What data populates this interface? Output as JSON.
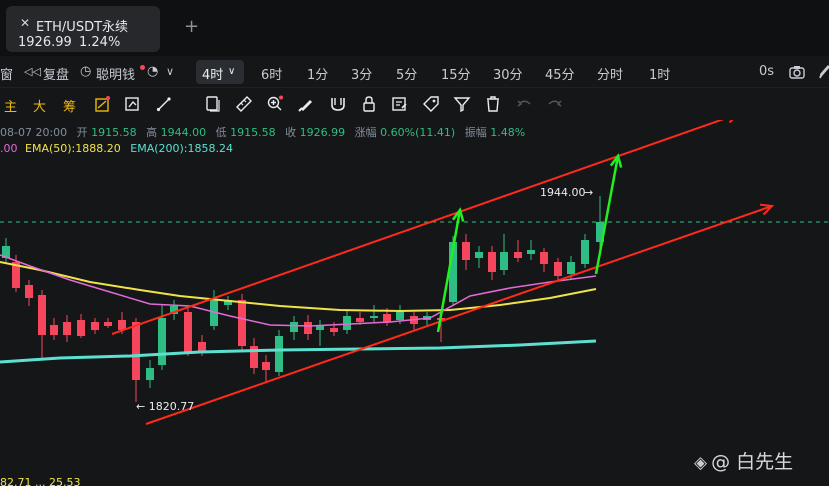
{
  "tab": {
    "close": "✕",
    "title": "ETH/USDT永续",
    "price": "1926.99",
    "change": "1.24%",
    "add": "+"
  },
  "toolbar1": {
    "window_label": "窗",
    "replay_label": "复盘",
    "smart_label": "聪明钱",
    "interval_active": "4时",
    "intervals": [
      "6时",
      "1分",
      "3分",
      "5分",
      "15分",
      "30分",
      "45分",
      "分时",
      "1时"
    ],
    "right_label": "0s"
  },
  "toolbar2": {
    "main_label": "主",
    "big_label": "大",
    "chip_label": "筹"
  },
  "info": {
    "date": "08-07 20:00",
    "open_label": "开",
    "open": "1915.58",
    "high_label": "高",
    "high": "1944.00",
    "low_label": "低",
    "low": "1915.58",
    "close_label": "收",
    "close": "1926.99",
    "chg_label": "涨幅",
    "chg": "0.60%(11.41)",
    "amp_label": "振幅",
    "amp": "1.48%"
  },
  "ema": {
    "first_value": ".00",
    "ema50_label": "EMA(50):1888.20",
    "ema200_label": "EMA(200):1858.24"
  },
  "annotations": {
    "high_marker": "1944.00",
    "low_marker": "← 1820.77",
    "bottom_left": "82.71 ... 25.53"
  },
  "watermark": "@ 白先生",
  "colors": {
    "up": "#2ebd85",
    "down": "#f6465d",
    "ema_yellow": "#f0e34a",
    "ema_pink": "#e26bd6",
    "ema_cyan": "#5ce0d0",
    "trend_red": "#ff2a1a",
    "arrow_green": "#22ee22",
    "accent": "#f0b90b"
  },
  "chart_data": {
    "type": "candlestick",
    "symbol": "ETH/USDT",
    "interval": "4时",
    "price_high_marker": 1944.0,
    "price_low_marker": 1820.77,
    "current_price": 1926.99
  }
}
